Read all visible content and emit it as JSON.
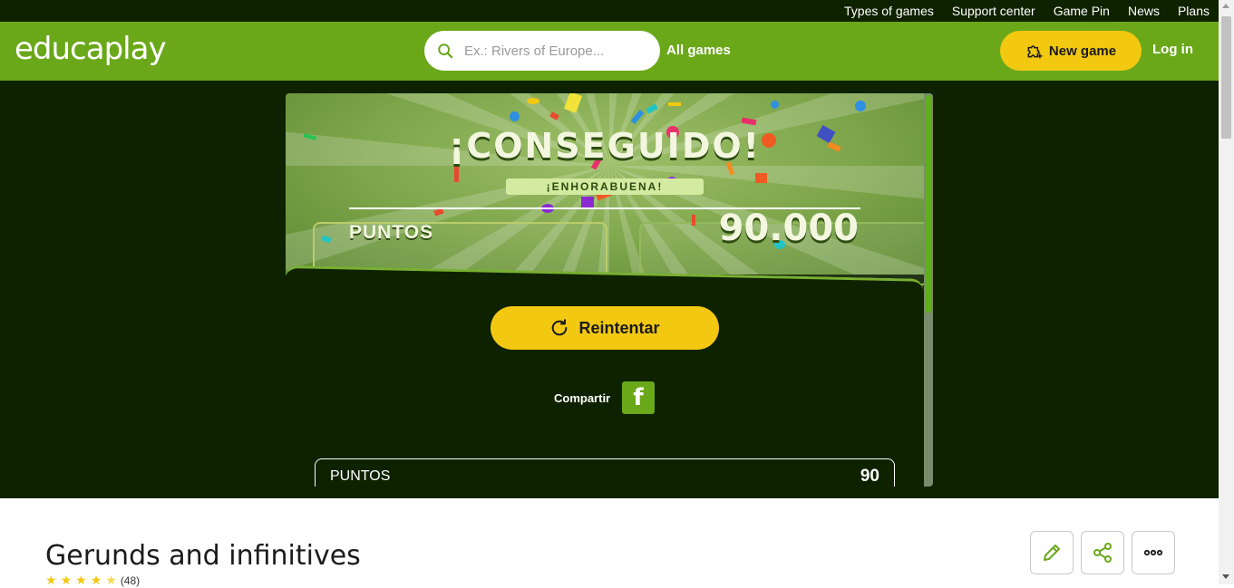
{
  "topnav": {
    "items": [
      "Types of games",
      "Support center",
      "Game Pin",
      "News",
      "Plans"
    ]
  },
  "header": {
    "logo_text": "educaplay",
    "search_placeholder": "Ex.: Rivers of Europe...",
    "all_games": "All games",
    "new_game": "New game",
    "login": "Log in"
  },
  "game": {
    "headline": "¡CONSEGUIDO!",
    "subheadline": "¡ENHORABUENA!",
    "points_label": "PUNTOS",
    "points_value": "90.000",
    "retry_label": "Reintentar",
    "share_label": "Compartir",
    "facebook_glyph": "f",
    "score_row_label": "PUNTOS",
    "score_row_value": "90"
  },
  "activity": {
    "title": "Gerunds and infinitives",
    "rating_count": "(48)",
    "rating_stars": 4.5
  },
  "colors": {
    "brand_green": "#6aa81a",
    "dark_bg": "#0f2200",
    "accent_yellow": "#f2c811"
  },
  "icons": [
    "search-icon",
    "puzzle-plus-icon",
    "retry-icon",
    "facebook-icon",
    "pencil-icon",
    "share-icon",
    "more-icon"
  ]
}
